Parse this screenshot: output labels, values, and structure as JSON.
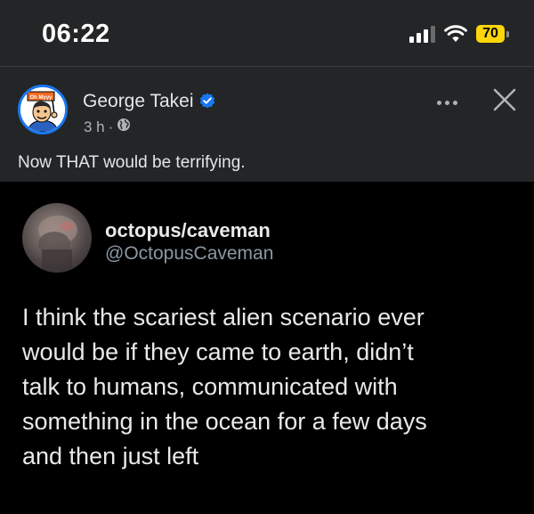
{
  "status_bar": {
    "time": "06:22",
    "battery": "70",
    "icons": [
      "cellular-signal-icon",
      "wifi-icon",
      "battery-icon"
    ]
  },
  "post": {
    "author": "George Takei",
    "verified": true,
    "time_ago": "3 h",
    "separator": "·",
    "audience_icon": "globe-icon",
    "caption": "Now THAT would be terrifying.",
    "avatar_badge_text": "Oh Myyy",
    "actions": [
      "more-options-icon",
      "close-icon"
    ]
  },
  "tweet": {
    "display_name": "octopus/caveman",
    "handle": "@OctopusCaveman",
    "text_lines": [
      "I think the scariest alien scenario ever",
      "would be if they came to earth, didn’t",
      "talk to humans, communicated with",
      "something in the ocean for a few days",
      "and then just left"
    ]
  },
  "colors": {
    "header_bg": "#242526",
    "tweet_bg": "#000000",
    "verified_blue": "#1877f2",
    "battery_yellow": "#ffd60a",
    "handle_gray": "#8b98a5"
  }
}
